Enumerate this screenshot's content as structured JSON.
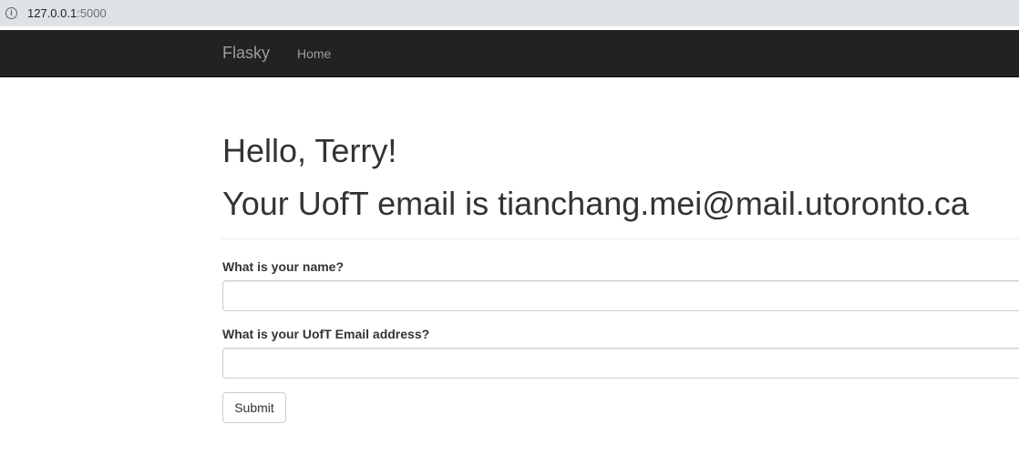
{
  "browser": {
    "url_host": "127.0.0.1",
    "url_port": ":5000",
    "info_icon": "info-icon"
  },
  "navbar": {
    "brand": "Flasky",
    "home_label": "Home"
  },
  "main": {
    "greeting": "Hello, Terry!",
    "email_message": "Your UofT email is tianchang.mei@mail.utoronto.ca"
  },
  "form": {
    "name_label": "What is your name?",
    "name_value": "",
    "email_label": "What is your UofT Email address?",
    "email_value": "",
    "submit_label": "Submit"
  }
}
